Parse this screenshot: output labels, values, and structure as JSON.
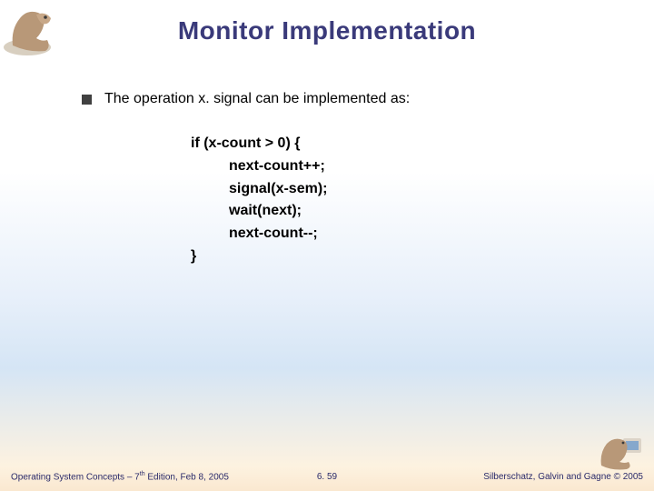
{
  "title": "Monitor Implementation",
  "bullet": {
    "prefix": "The operation ",
    "op": "x. signal",
    "suffix": " can be implemented as:"
  },
  "code": {
    "l1": "if (x-count > 0) {",
    "l2": "next-count++;",
    "l3": "signal(x-sem);",
    "l4": "wait(next);",
    "l5": "next-count--;",
    "l6": "}"
  },
  "footer": {
    "left_prefix": "Operating System Concepts – 7",
    "left_sup": "th",
    "left_suffix": " Edition, Feb 8, 2005",
    "center": "6. 59",
    "right": "Silberschatz, Galvin and Gagne © 2005"
  }
}
